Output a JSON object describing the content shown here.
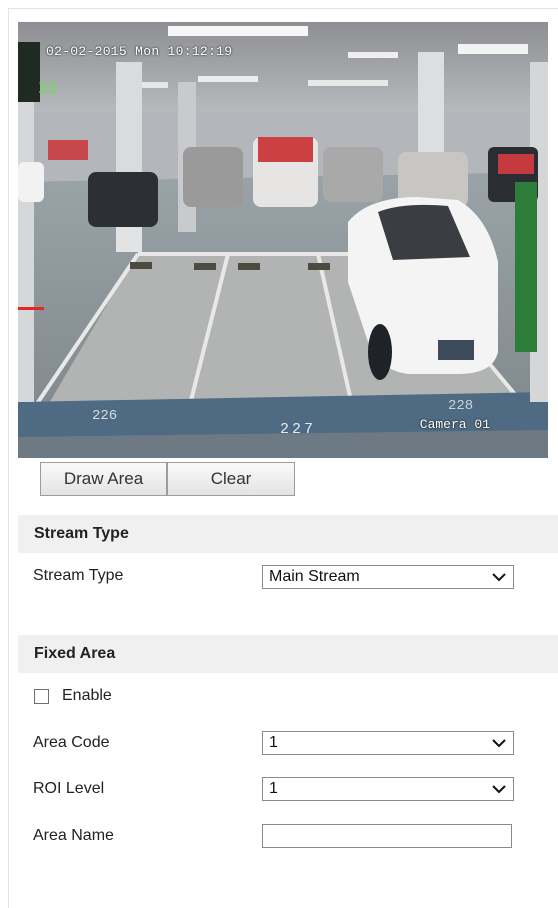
{
  "video": {
    "osd_date": "02-02-2015 Mon 10:12:19",
    "osd_camera": "Camera 01",
    "led_text": "12",
    "spot_labels": [
      "226",
      "227",
      "228"
    ]
  },
  "toolbar": {
    "draw_area_label": "Draw Area",
    "clear_label": "Clear"
  },
  "stream_section": {
    "title": "Stream Type",
    "stream_type_label": "Stream Type",
    "stream_type_value": "Main Stream"
  },
  "fixed_area_section": {
    "title": "Fixed Area",
    "enable_label": "Enable",
    "enable_checked": false,
    "area_code_label": "Area Code",
    "area_code_value": "1",
    "roi_level_label": "ROI Level",
    "roi_level_value": "1",
    "area_name_label": "Area Name",
    "area_name_value": ""
  }
}
